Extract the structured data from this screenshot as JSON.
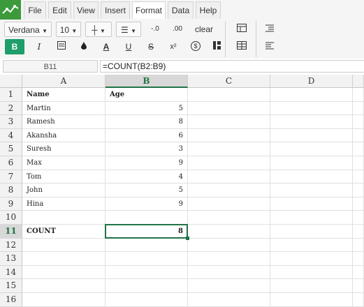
{
  "menu": {
    "file": "File",
    "edit": "Edit",
    "view": "View",
    "insert": "Insert",
    "format": "Format",
    "data": "Data",
    "help": "Help"
  },
  "toolbar": {
    "font_family": "Verdana",
    "font_size": "10",
    "clear_label": "clear",
    "bold": "B",
    "italic": "I",
    "underline_color": "A",
    "underline": "U",
    "strike": "S",
    "superscript": "x²",
    "currency": "$",
    "decimal_less": "-.0",
    "decimal_more": ".00"
  },
  "formula_bar": {
    "cell_ref": "B11",
    "formula": "=COUNT(B2:B9)"
  },
  "columns": [
    "A",
    "B",
    "C",
    "D"
  ],
  "rows": [
    "1",
    "2",
    "3",
    "4",
    "5",
    "6",
    "7",
    "8",
    "9",
    "10",
    "11",
    "12",
    "13",
    "14",
    "15",
    "16"
  ],
  "cells": {
    "A1": "Name",
    "B1": "Age",
    "A2": "Martin",
    "B2": "5",
    "A3": "Ramesh",
    "B3": "8",
    "A4": "Akansha",
    "B4": "6",
    "A5": "Suresh",
    "B5": "3",
    "A6": "Max",
    "B6": "9",
    "A7": "Tom",
    "B7": "4",
    "A8": "John",
    "B8": "5",
    "A9": "Hina",
    "B9": "9",
    "A11": "COUNT",
    "B11": "8"
  },
  "colors": {
    "accent": "#217346",
    "bold_button": "#1e9e6a",
    "logo": "#3c9a3c"
  }
}
